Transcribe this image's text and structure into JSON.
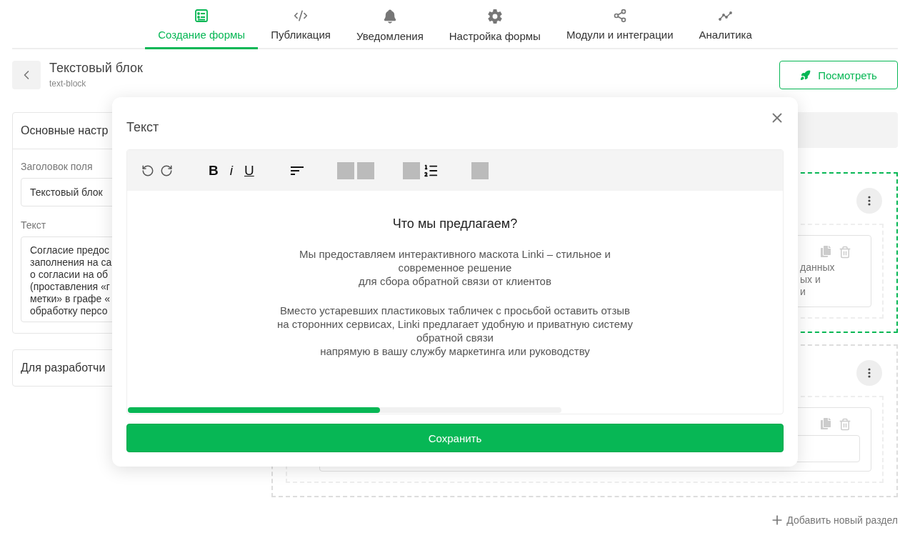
{
  "tabs": [
    {
      "label": "Создание формы",
      "selected": true
    },
    {
      "label": "Публикация",
      "selected": false
    },
    {
      "label": "Уведомления",
      "selected": false
    },
    {
      "label": "Настройка формы",
      "selected": false
    },
    {
      "label": "Модули и интеграции",
      "selected": false
    },
    {
      "label": "Аналитика",
      "selected": false
    }
  ],
  "header": {
    "title": "Текстовый блок",
    "subtitle": "text-block",
    "preview_button": "Посмотреть"
  },
  "settings_panel": {
    "title": "Основные настр",
    "field_label": "Заголовок поля",
    "field_value": "Текстовый блок",
    "text_label": "Текст",
    "text_lines": [
      "Согласие предос",
      "заполнения на са",
      "о согласии на об",
      "(проставления «г",
      "метки» в графе «",
      "обработку персо"
    ]
  },
  "developer_panel": {
    "title": "Для разработчи"
  },
  "section_card_text": [
    "данных",
    "ых и",
    "и"
  ],
  "add_section": "Добавить новый раздел",
  "modal": {
    "title": "Текст",
    "format_buttons": [
      "B",
      "i",
      "U"
    ],
    "heading": "Что мы предлагаем?",
    "paragraphs": [
      [
        "Мы предоставляем интерактивного маскота Linki – стильное и",
        "современное решение",
        "для сбора обратной связи от клиентов"
      ],
      [
        "Вместо устаревших пластиковых табличек с просьбой оставить отзыв",
        "на сторонних сервисах, Linki предлагает удобную и приватную систему",
        "обратной связи",
        "напрямую в вашу службу маркетинга или руководству"
      ]
    ],
    "save_button": "Сохранить"
  }
}
